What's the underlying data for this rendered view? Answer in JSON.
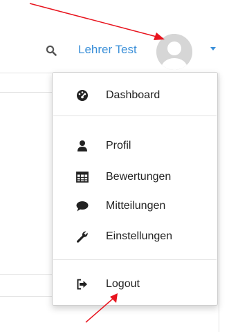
{
  "navbar": {
    "search_icon": "search-icon",
    "user_name": "Lehrer Test",
    "avatar_icon": "avatar-placeholder",
    "caret_icon": "caret-down-icon",
    "link_color": "#3a8fd8"
  },
  "dropdown": {
    "items": [
      {
        "label": "Dashboard",
        "icon": "dashboard-icon"
      },
      {
        "label": "Profil",
        "icon": "user-icon"
      },
      {
        "label": "Bewertungen",
        "icon": "table-icon"
      },
      {
        "label": "Mitteilungen",
        "icon": "comment-icon"
      },
      {
        "label": "Einstellungen",
        "icon": "wrench-icon"
      },
      {
        "label": "Logout",
        "icon": "sign-out-icon"
      }
    ]
  },
  "annotations": {
    "arrow_color": "#e8141e"
  }
}
